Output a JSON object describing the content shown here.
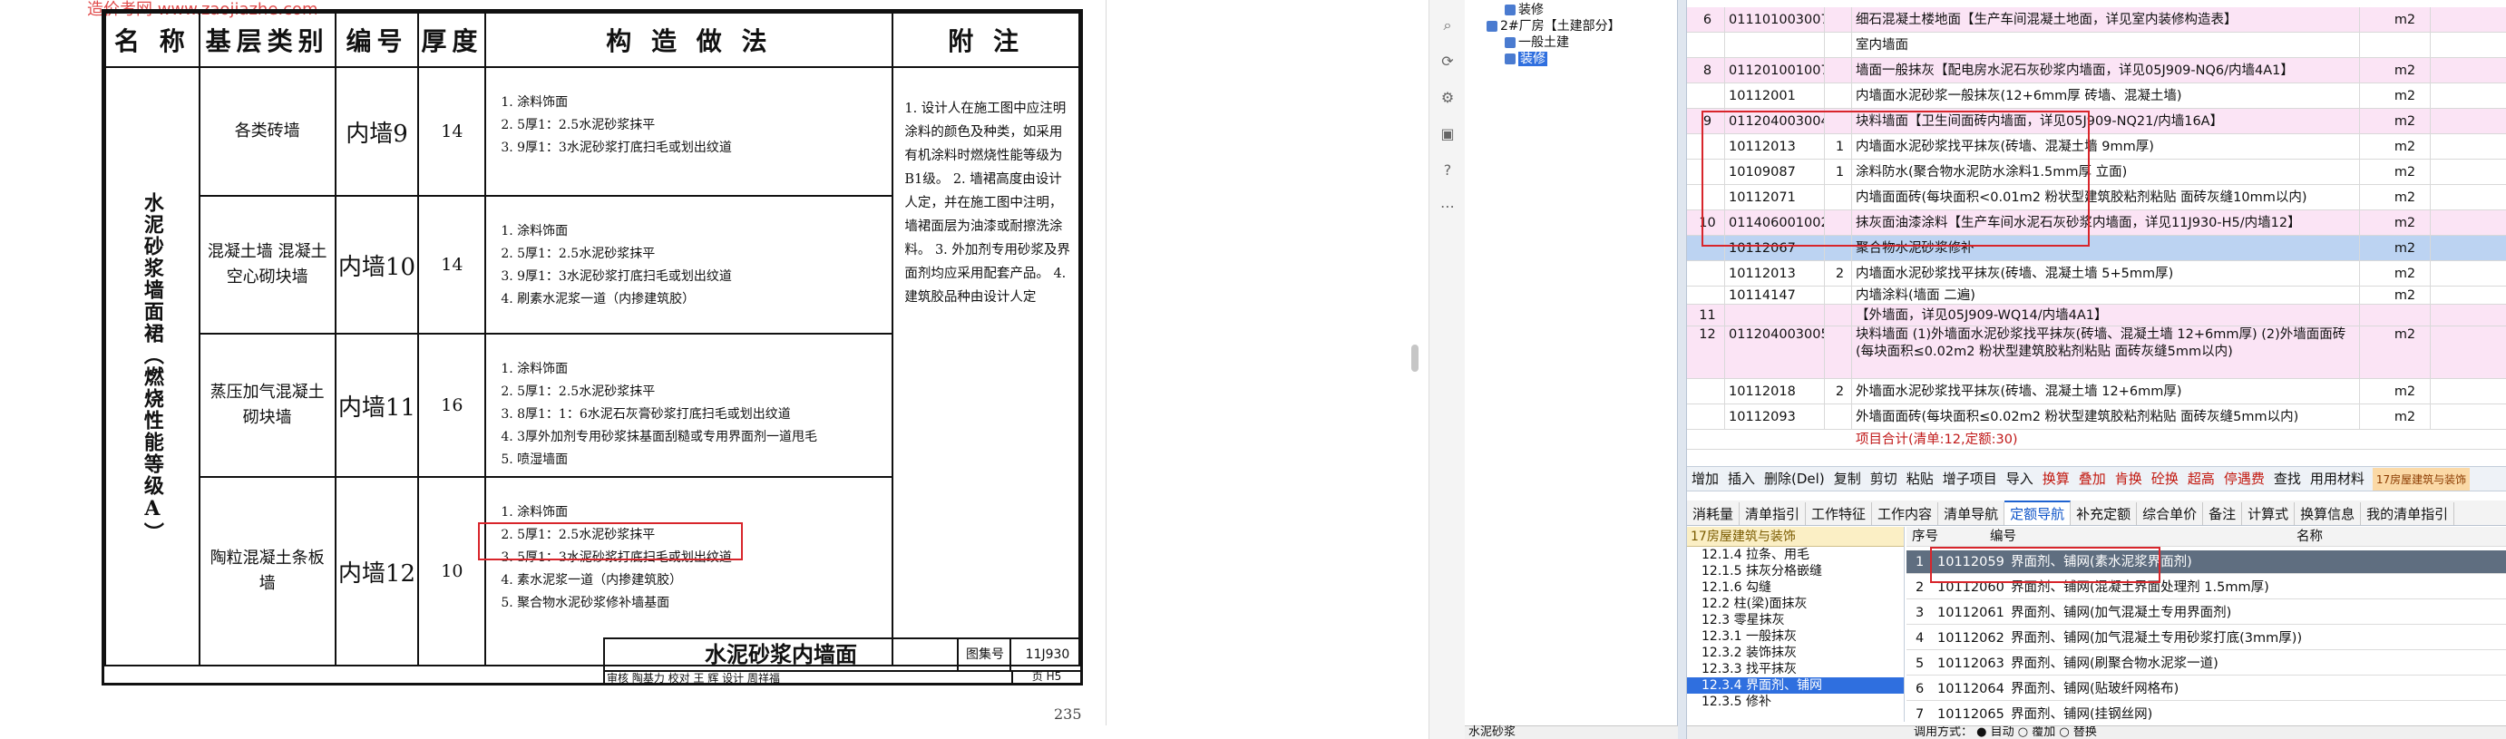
{
  "pdf": {
    "watermark": "造价考网 www.zaojiazhe.com",
    "page_number": "235",
    "table_headers": [
      "名 称",
      "基层类别",
      "编号",
      "厚度",
      "构 造 做 法",
      "附 注"
    ],
    "name_cell": "水泥砂浆墙面裙（燃烧性能等级A）",
    "rows": [
      {
        "base": "各类砖墙",
        "code": "内墙9",
        "thickness": "14",
        "steps": [
          "1. 涂料饰面",
          "2. 5厚1：2.5水泥砂浆抹平",
          "3. 9厚1：3水泥砂浆打底扫毛或划出纹道"
        ]
      },
      {
        "base": "混凝土墙 混凝土空心砌块墙",
        "code": "内墙10",
        "thickness": "14",
        "steps": [
          "1. 涂料饰面",
          "2. 5厚1：2.5水泥砂浆抹平",
          "3. 9厚1：3水泥砂浆打底扫毛或划出纹道",
          "4. 刷素水泥浆一道（内掺建筑胶）"
        ]
      },
      {
        "base": "蒸压加气混凝土砌块墙",
        "code": "内墙11",
        "thickness": "16",
        "steps": [
          "1. 涂料饰面",
          "2. 5厚1：2.5水泥砂浆抹平",
          "3. 8厚1：1：6水泥石灰膏砂浆打底扫毛或划出纹道",
          "4. 3厚外加剂专用砂浆抹基面刮糙或专用界面剂一道甩毛",
          "5. 喷湿墙面"
        ]
      },
      {
        "base": "陶粒混凝土条板墙",
        "code": "内墙12",
        "thickness": "10",
        "steps": [
          "1. 涂料饰面",
          "2. 5厚1：2.5水泥砂浆抹平",
          "3. 5厚1：3水泥砂浆打底扫毛或划出纹道",
          "4. 素水泥浆一道（内掺建筑胶）",
          "5. 聚合物水泥砂浆修补墙基面"
        ]
      }
    ],
    "notes": "1. 设计人在施工图中应注明涂料的颜色及种类，如采用有机涂料时燃烧性能等级为B1级。 2. 墙裙高度由设计人定，并在施工图中注明，墙裙面层为油漆或耐擦洗涂料。 3. 外加剂专用砂浆及界面剂均应采用配套产品。 4. 建筑胶品种由设计人定",
    "title_block": {
      "title": "水泥砂浆内墙面",
      "atlas_label": "图集号",
      "atlas_no": "11J930",
      "sign_line": "审核 陶基力 校对 王 辉 设计 周祥福",
      "page_label": "页",
      "page_no": "H5"
    }
  },
  "app": {
    "tree": [
      {
        "label": "装修",
        "indent": 1
      },
      {
        "label": "2#厂房【土建部分】",
        "indent": 0
      },
      {
        "label": "一般土建",
        "indent": 1
      },
      {
        "label": "装修",
        "indent": 1,
        "selected": true
      }
    ],
    "grid_rows": [
      {
        "seq": "6",
        "code": "011101003007",
        "qty": "",
        "name": "细石混凝土楼地面【生产车间混凝土地面，详见室内装修构造表】",
        "unit": "m2",
        "kind": "pink"
      },
      {
        "seq": "",
        "code": "",
        "qty": "",
        "name": "室内墙面",
        "unit": "",
        "kind": "white"
      },
      {
        "seq": "8",
        "code": "011201001007",
        "qty": "",
        "name": "墙面一般抹灰【配电房水泥石灰砂浆内墙面，详见05J909-NQ6/内墙4A1】",
        "unit": "m2",
        "kind": "pink"
      },
      {
        "seq": "",
        "code": "10112001",
        "qty": "",
        "name": "内墙面水泥砂浆一般抹灰(12+6mm厚 砖墙、混凝土墙)",
        "unit": "m2",
        "kind": "white"
      },
      {
        "seq": "9",
        "code": "011204003004",
        "qty": "",
        "name": "块料墙面【卫生间面砖内墙面，详见05J909-NQ21/内墙16A】",
        "unit": "m2",
        "kind": "pink"
      },
      {
        "seq": "",
        "code": "10112013",
        "qty": "1",
        "name": "内墙面水泥砂浆找平抹灰(砖墙、混凝土墙 9mm厚)",
        "unit": "m2",
        "kind": "white"
      },
      {
        "seq": "",
        "code": "10109087",
        "qty": "1",
        "name": "涂料防水(聚合物水泥防水涂料1.5mm厚 立面)",
        "unit": "m2",
        "kind": "white"
      },
      {
        "seq": "",
        "code": "10112071",
        "qty": "",
        "name": "内墙面面砖(每块面积<0.01m2 粉状型建筑胶粘剂粘贴 面砖灰缝10mm以内)",
        "unit": "m2",
        "kind": "white"
      },
      {
        "seq": "10",
        "code": "011406001002",
        "qty": "",
        "name": "抹灰面油漆涂料【生产车间水泥石灰砂浆内墙面，详见11J930-H5/内墙12】",
        "unit": "m2",
        "kind": "pink"
      },
      {
        "seq": "",
        "code": "10112067",
        "qty": "",
        "name": "聚合物水泥砂浆修补",
        "unit": "m2",
        "kind": "selrow"
      },
      {
        "seq": "",
        "code": "10112013",
        "qty": "2",
        "name": "内墙面水泥砂浆找平抹灰(砖墙、混凝土墙 5+5mm厚)",
        "unit": "m2",
        "kind": "white"
      },
      {
        "seq": "",
        "code": "10114147",
        "qty": "",
        "name": "内墙涂料(墙面 二遍)",
        "unit": "m2",
        "kind": "white"
      },
      {
        "seq": "11",
        "code": "",
        "qty": "",
        "name": "【外墙面，详见05J909-WQ14/内墙4A1】",
        "unit": "",
        "kind": "pink"
      },
      {
        "seq": "12",
        "code": "011204003005",
        "qty": "",
        "name": "块料墙面 (1)外墙面水泥砂浆找平抹灰(砖墙、混凝土墙 12+6mm厚) (2)外墙面面砖(每块面积≤0.02m2 粉状型建筑胶粘剂粘贴 面砖灰缝5mm以内)",
        "unit": "m2",
        "kind": "pink"
      },
      {
        "seq": "",
        "code": "10112018",
        "qty": "2",
        "name": "外墙面水泥砂浆找平抹灰(砖墙、混凝土墙 12+6mm厚)",
        "unit": "m2",
        "kind": "white"
      },
      {
        "seq": "",
        "code": "10112093",
        "qty": "",
        "name": "外墙面面砖(每块面积≤0.02m2 粉状型建筑胶粘剂粘贴 面砖灰缝5mm以内)",
        "unit": "m2",
        "kind": "white"
      }
    ],
    "summary": "项目合计(清单:12,定额:30)",
    "menu": [
      {
        "label": "增加",
        "red": false
      },
      {
        "label": "插入",
        "red": false
      },
      {
        "label": "删除(Del)",
        "red": false
      },
      {
        "label": "复制",
        "red": false
      },
      {
        "label": "剪切",
        "red": false
      },
      {
        "label": "粘贴",
        "red": false
      },
      {
        "label": "增子项目",
        "red": false
      },
      {
        "label": "导入",
        "red": false
      },
      {
        "label": "换算",
        "red": true
      },
      {
        "label": "叠加",
        "red": true
      },
      {
        "label": "肯换",
        "red": true
      },
      {
        "label": "砼换",
        "red": true
      },
      {
        "label": "超高",
        "red": true
      },
      {
        "label": "停遇费",
        "red": true
      },
      {
        "label": "查找",
        "red": false
      },
      {
        "label": "用用材料",
        "red": false
      }
    ],
    "quota_badge": "17房屋建筑与装饰",
    "tabs": [
      {
        "label": "消耗量",
        "active": false
      },
      {
        "label": "清单指引",
        "active": false
      },
      {
        "label": "工作特征",
        "active": false
      },
      {
        "label": "工作内容",
        "active": false
      },
      {
        "label": "清单导航",
        "active": false
      },
      {
        "label": "定额导航",
        "active": true
      },
      {
        "label": "补充定额",
        "active": false
      },
      {
        "label": "综合单价",
        "active": false
      },
      {
        "label": "备注",
        "active": false
      },
      {
        "label": "计算式",
        "active": false
      },
      {
        "label": "换算信息",
        "active": false
      },
      {
        "label": "我的清单指引",
        "active": false
      }
    ],
    "qtree_header": "17房屋建筑与装饰",
    "qtree": [
      {
        "label": "12.1.4 拉条、用毛",
        "selected": false
      },
      {
        "label": "12.1.5 抹灰分格嵌缝",
        "selected": false
      },
      {
        "label": "12.1.6 勾缝",
        "selected": false
      },
      {
        "label": "12.2 柱(梁)面抹灰",
        "selected": false
      },
      {
        "label": "12.3 零星抹灰",
        "selected": false
      },
      {
        "label": "12.3.1 一般抹灰",
        "selected": false
      },
      {
        "label": "12.3.2 装饰抹灰",
        "selected": false
      },
      {
        "label": "12.3.3 找平抹灰",
        "selected": false
      },
      {
        "label": "12.3.4 界面剂、铺网",
        "selected": true
      },
      {
        "label": "12.3.5 修补",
        "selected": false
      }
    ],
    "qgrid_headers": {
      "seq": "序号",
      "code": "编号",
      "name": "名称"
    },
    "qgrid": [
      {
        "seq": "1",
        "code": "10112059",
        "name": "界面剂、铺网(素水泥浆界面剂)",
        "selected": true
      },
      {
        "seq": "2",
        "code": "10112060",
        "name": "界面剂、铺网(混凝土界面处理剂 1.5mm厚)",
        "selected": false
      },
      {
        "seq": "3",
        "code": "10112061",
        "name": "界面剂、铺网(加气混凝土专用界面剂)",
        "selected": false
      },
      {
        "seq": "4",
        "code": "10112062",
        "name": "界面剂、铺网(加气混凝土专用砂浆打底(3mm厚))",
        "selected": false
      },
      {
        "seq": "5",
        "code": "10112063",
        "name": "界面剂、铺网(刷聚合物水泥浆一道)",
        "selected": false
      },
      {
        "seq": "6",
        "code": "10112064",
        "name": "界面剂、铺网(贴玻纤网格布)",
        "selected": false
      },
      {
        "seq": "7",
        "code": "10112065",
        "name": "界面剂、铺网(挂钢丝网)",
        "selected": false
      }
    ],
    "status_left": "水泥砂浆",
    "status_right": "调用方式： ● 目动 ○ 覆加 ○ 替换"
  }
}
